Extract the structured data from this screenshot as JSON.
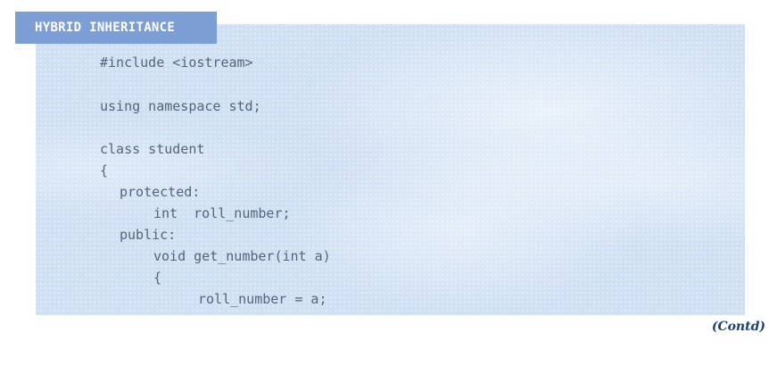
{
  "title": "HYBRID INHERITANCE",
  "code": {
    "lines": [
      "#include <iostream>",
      "using namespace std;",
      "class student",
      "{",
      "protected:",
      "int  roll_number;",
      "public:",
      "void get_number(int a)",
      "{",
      "roll_number = a;"
    ]
  },
  "footer": {
    "contd": "(Contd)"
  },
  "colors": {
    "panel_background": "#cfe0f3",
    "title_tab": "#7c9ed4",
    "code_text": "#55657a",
    "contd_text": "#1f3e73"
  }
}
